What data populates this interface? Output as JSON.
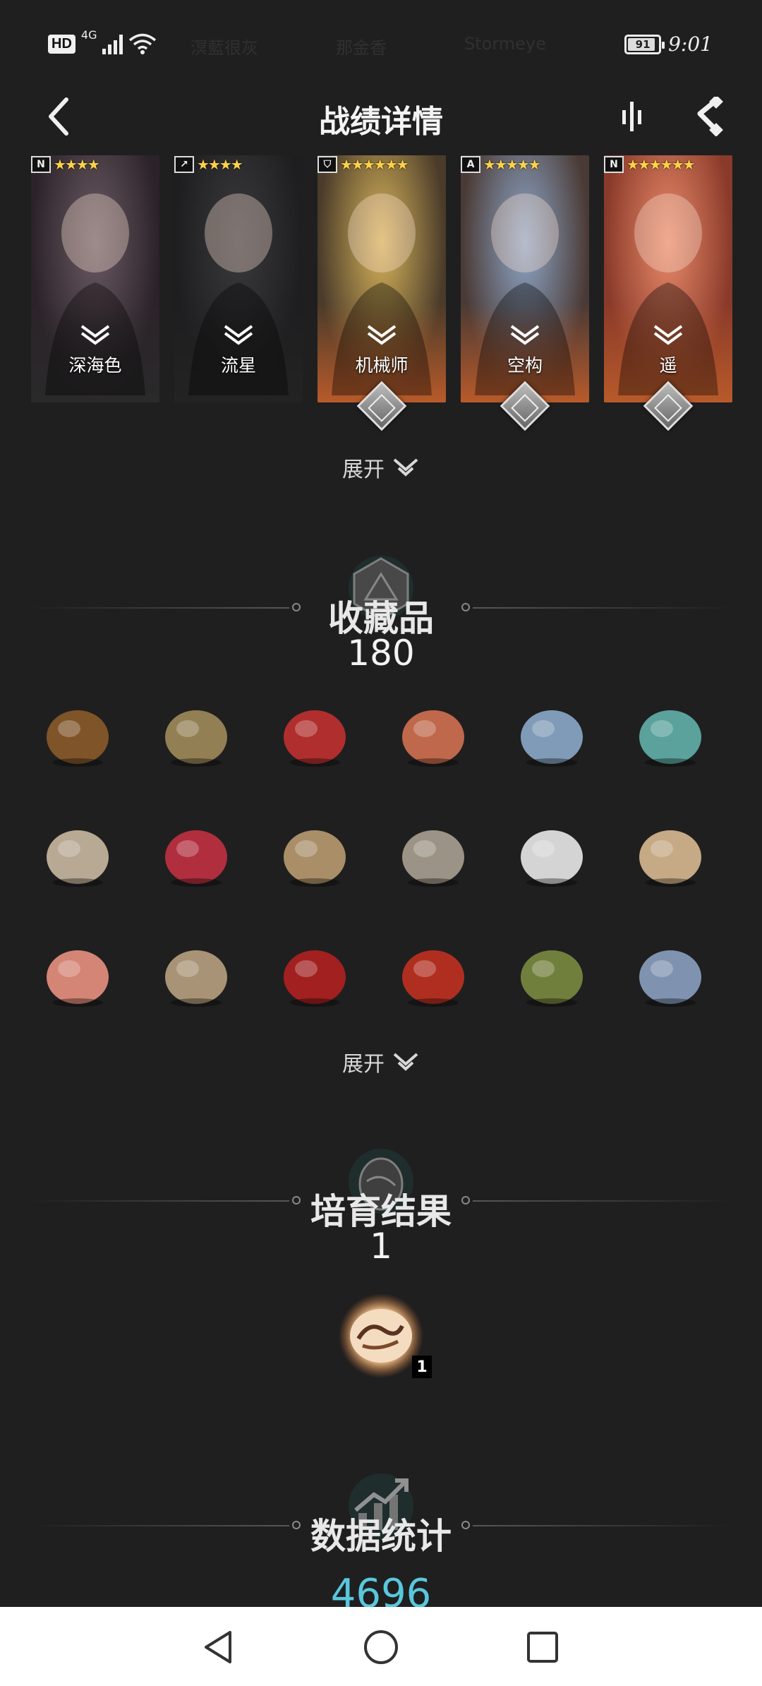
{
  "status_bar": {
    "hd_label": "HD",
    "network_label": "4G",
    "battery_level": "91",
    "battery_percent": 91,
    "time": "9:01",
    "faded_names": [
      "溟藍很灰",
      "那金香",
      "Stormeye"
    ]
  },
  "header": {
    "title": "战绩详情",
    "icons": {
      "back": "back-chevron-icon",
      "stats": "bar-stats-icon",
      "share": "share-icon"
    }
  },
  "characters": [
    {
      "name": "深海色",
      "stars": "★★★★",
      "class_glyph": "N",
      "card_colors": [
        "#6b5a63",
        "#2b2329"
      ],
      "bottom_color": "#2a2a2a",
      "badge": false
    },
    {
      "name": "流星",
      "stars": "★★★★",
      "class_glyph": "↗",
      "card_colors": [
        "#3a3a3d",
        "#1e1e20"
      ],
      "bottom_color": "#232323",
      "badge": false
    },
    {
      "name": "机械师",
      "stars": "★★★★★★",
      "class_glyph": "⛉",
      "card_colors": [
        "#d6b35a",
        "#4a3b2a"
      ],
      "bottom_color": "#b85a2a",
      "badge": true
    },
    {
      "name": "空构",
      "stars": "★★★★★",
      "class_glyph": "A",
      "card_colors": [
        "#8ea7c8",
        "#4a3a35"
      ],
      "bottom_color": "#b85a2a",
      "badge": true
    },
    {
      "name": "遥",
      "stars": "★★★★★★",
      "class_glyph": "N",
      "card_colors": [
        "#e88a6a",
        "#8a3a2a"
      ],
      "bottom_color": "#b85a2a",
      "badge": true
    }
  ],
  "expand_label": "展开",
  "collectibles_section": {
    "title": "收藏品",
    "count": "180",
    "emblem": "d20-dice-icon",
    "items": [
      {
        "name": "acorn-icon",
        "color": "#8a5a2a"
      },
      {
        "name": "old-scroll-icon",
        "color": "#a08a5a"
      },
      {
        "name": "candy-bars-icon",
        "color": "#c03030"
      },
      {
        "name": "sparkle-cloud-icon",
        "color": "#d07050"
      },
      {
        "name": "moon-ice-icon",
        "color": "#8aa8c8"
      },
      {
        "name": "teal-cloud-icon",
        "color": "#60b0a8"
      },
      {
        "name": "open-book-icon",
        "color": "#c8b8a0"
      },
      {
        "name": "rose-vase-icon",
        "color": "#c03040"
      },
      {
        "name": "bronze-medal-icon",
        "color": "#b89a70"
      },
      {
        "name": "silver-plate-icon",
        "color": "#a8a090"
      },
      {
        "name": "white-coral-icon",
        "color": "#e8e8e8"
      },
      {
        "name": "crossed-fish-icon",
        "color": "#d8b890"
      },
      {
        "name": "pink-feather-icon",
        "color": "#e89080"
      },
      {
        "name": "rolled-map-icon",
        "color": "#b8a080"
      },
      {
        "name": "red-ribbon-icon",
        "color": "#b02020"
      },
      {
        "name": "red-lantern-flower-icon",
        "color": "#c03020"
      },
      {
        "name": "venus-flytrap-icon",
        "color": "#7a8a40"
      },
      {
        "name": "crystal-cluster-icon",
        "color": "#8aa0c0"
      }
    ]
  },
  "breeding_section": {
    "title": "培育结果",
    "count": "1",
    "emblem": "egg-icon",
    "item": {
      "name": "dragon-egg-icon",
      "count": "1"
    }
  },
  "stats_section": {
    "title": "数据统计",
    "emblem": "chart-up-icon",
    "value": "4696"
  },
  "nav_bar": {
    "back": "nav-back-icon",
    "home": "nav-home-icon",
    "recents": "nav-recents-icon"
  }
}
